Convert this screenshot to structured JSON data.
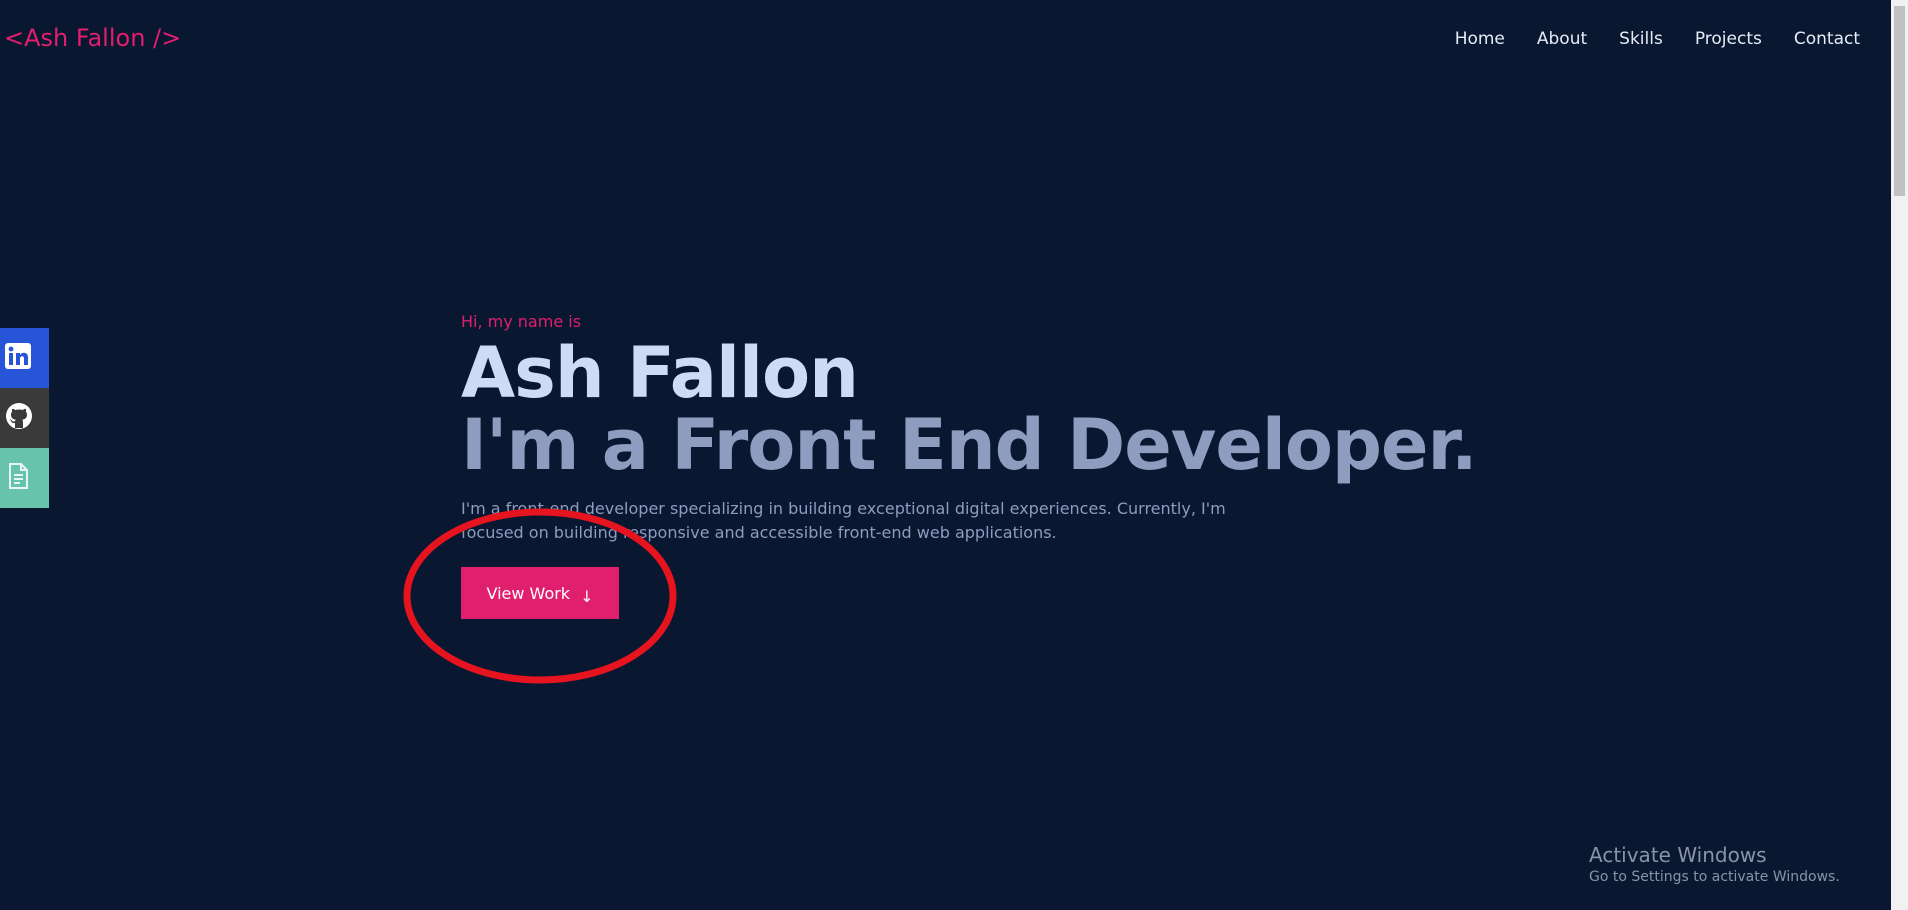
{
  "header": {
    "logo": "<Ash Fallon />",
    "nav": [
      "Home",
      "About",
      "Skills",
      "Projects",
      "Contact"
    ]
  },
  "social": {
    "items": [
      {
        "icon": "linkedin-icon",
        "color": "#2755d8"
      },
      {
        "icon": "github-icon",
        "color": "#3a3a3a"
      },
      {
        "icon": "document-icon",
        "color": "#68c3ac"
      }
    ]
  },
  "hero": {
    "intro": "Hi, my name is",
    "name": "Ash Fallon",
    "role": "I'm a Front End Developer.",
    "description": "I'm a front-end developer specializing in building exceptional digital experiences. Currently, I'm focused on building responsive and accessible front-end web applications.",
    "button_label": "View Work",
    "button_arrow": "↓"
  },
  "watermark": {
    "title": "Activate Windows",
    "subtitle": "Go to Settings to activate Windows."
  },
  "colors": {
    "background": "#0a1730",
    "accent": "#e01f6f",
    "heading": "#cfdaf5",
    "muted": "#8d9cbf",
    "annotation": "#e5141f"
  }
}
